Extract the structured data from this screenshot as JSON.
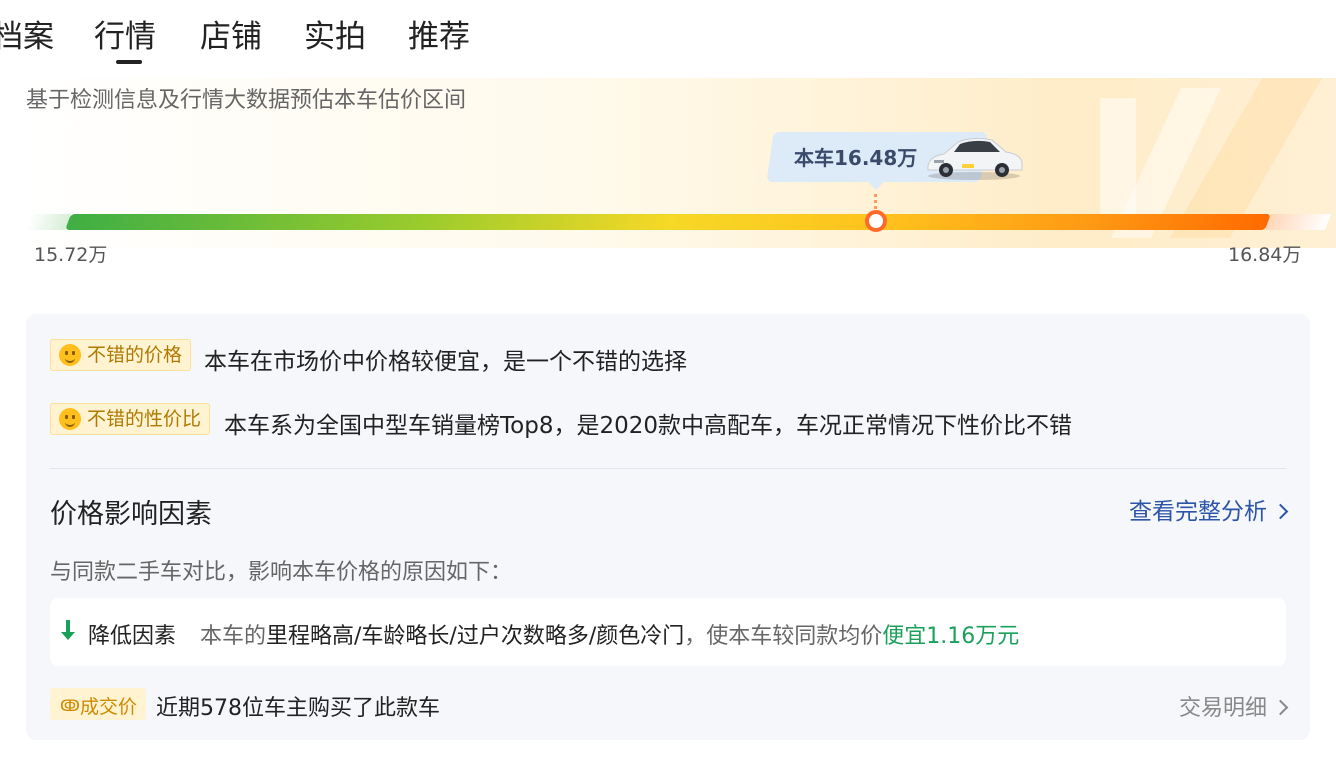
{
  "tabs": [
    "档案",
    "行情",
    "店铺",
    "实拍",
    "推荐"
  ],
  "active_tab_index": 1,
  "range": {
    "subtitle": "基于检测信息及行情大数据预估本车估价区间",
    "current_label": "本车16.48万",
    "min_label": "15.72万",
    "max_label": "16.84万",
    "min_value": 15.72,
    "max_value": 16.84,
    "current_value": 16.48
  },
  "evaluations": [
    {
      "badge": "不错的价格",
      "text": "本车在市场价中价格较便宜，是一个不错的选择"
    },
    {
      "badge": "不错的性价比",
      "text": "本车系为全国中型车销量榜Top8，是2020款中高配车，车况正常情况下性价比不错"
    }
  ],
  "factors": {
    "title": "价格影响因素",
    "link": "查看完整分析",
    "compare_text": "与同款二手车对比，影响本车价格的原因如下：",
    "reduce_label": "降低因素",
    "reduce_prefix": "本车的",
    "reduce_items": "里程略高/车龄略长/过户次数略多/颜色冷门",
    "reduce_middle": "，使本车较同款均价",
    "reduce_result": "便宜1.16万元"
  },
  "deal": {
    "badge": "成交价",
    "text": "近期578位车主购买了此款车",
    "link": "交易明细"
  },
  "colors": {
    "accent_blue": "#2c55a8",
    "green": "#1aa05a",
    "badge_gold": "#b07a00",
    "marker": "#ff6a2b"
  }
}
